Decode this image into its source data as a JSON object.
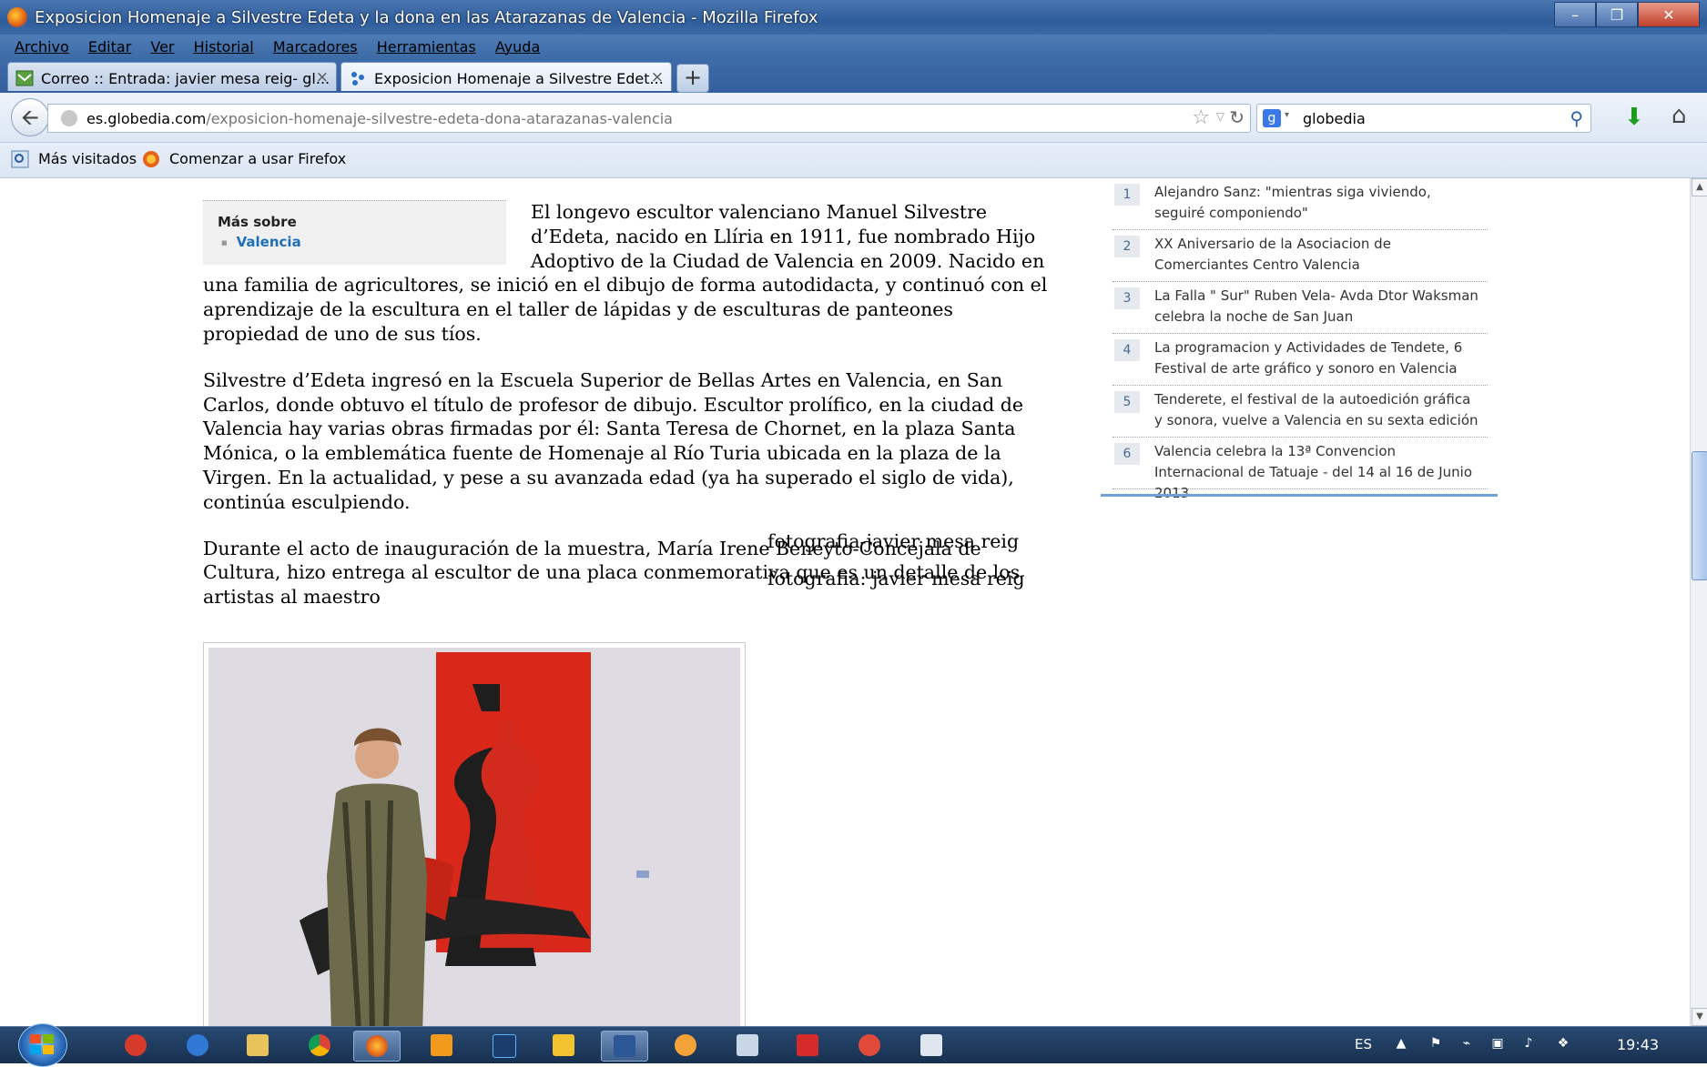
{
  "window": {
    "title": "Exposicion Homenaje a Silvestre Edeta y la dona en las Atarazanas de Valencia - Mozilla Firefox",
    "controls": [
      "–",
      "❐",
      "✕"
    ]
  },
  "menu": [
    "Archivo",
    "Editar",
    "Ver",
    "Historial",
    "Marcadores",
    "Herramientas",
    "Ayuda"
  ],
  "tabs": [
    {
      "label": "Correo :: Entrada: javier mesa reig- gl...",
      "close": "×"
    },
    {
      "label": "Exposicion Homenaje a Silvestre Edet...",
      "close": "×"
    }
  ],
  "new_tab": "+",
  "navbar": {
    "url_domain": "es.globedia.com",
    "url_path": "/exposicion-homenaje-silvestre-edeta-dona-atarazanas-valencia",
    "search_engine": "Google",
    "search_value": "globedia"
  },
  "bookmarks": [
    "Más visitados",
    "Comenzar a usar Firefox"
  ],
  "more_box": {
    "heading": "Más sobre",
    "link": "Valencia"
  },
  "article": {
    "paragraphs": [
      "El longevo escultor valenciano Manuel Silvestre d’Edeta, nacido en Llíria en 1911, fue nombrado Hijo Adoptivo de la Ciudad de Valencia en 2009. Nacido en una familia de agricultores, se inició en el dibujo de forma autodidacta, y continuó con el aprendizaje de la escultura en el taller de lápidas y de esculturas de panteones propiedad de uno de sus tíos.",
      "Silvestre d’Edeta ingresó en la Escuela Superior de Bellas Artes en Valencia, en San Carlos, donde obtuvo el título de profesor de dibujo. Escultor prolífico, en la ciudad de Valencia hay varias obras firmadas por él: Santa Teresa de Chornet, en la plaza Santa Mónica, o la emblemática fuente de Homenaje al Río Turia ubicada en la plaza de la Virgen. En la actualidad, y pese a su avanzada edad (ya ha superado el siglo de vida), continúa esculpiendo.",
      "Durante el acto de inauguración de la muestra, María Irene Beneyto-Concejala de Cultura, hizo entrega al escultor de una placa conmemorativa que es un detalle de los artistas al maestro"
    ],
    "captions": [
      "fotografia-javier mesa reig",
      "fotografia: javier mesa reig"
    ]
  },
  "sidebar": {
    "items": [
      {
        "num": "1",
        "text": "Alejandro Sanz: \"mientras siga viviendo, seguiré componiendo\""
      },
      {
        "num": "2",
        "text": "XX Aniversario de la Asociacion de Comerciantes Centro Valencia"
      },
      {
        "num": "3",
        "text": "La Falla \" Sur\" Ruben Vela- Avda Dtor Waksman celebra la noche de San Juan"
      },
      {
        "num": "4",
        "text": "La programacion y Actividades de Tendete, 6 Festival de arte gráfico y sonoro en Valencia"
      },
      {
        "num": "5",
        "text": "Tenderete, el festival de la autoedición gráfica y sonora, vuelve a Valencia en su sexta edición"
      },
      {
        "num": "6",
        "text": "Valencia celebra la 13ª Convencion Internacional de Tatuaje - del 14 al 16 de Junio 2013"
      }
    ]
  },
  "taskbar": {
    "lang": "ES",
    "clock": "19:43"
  }
}
